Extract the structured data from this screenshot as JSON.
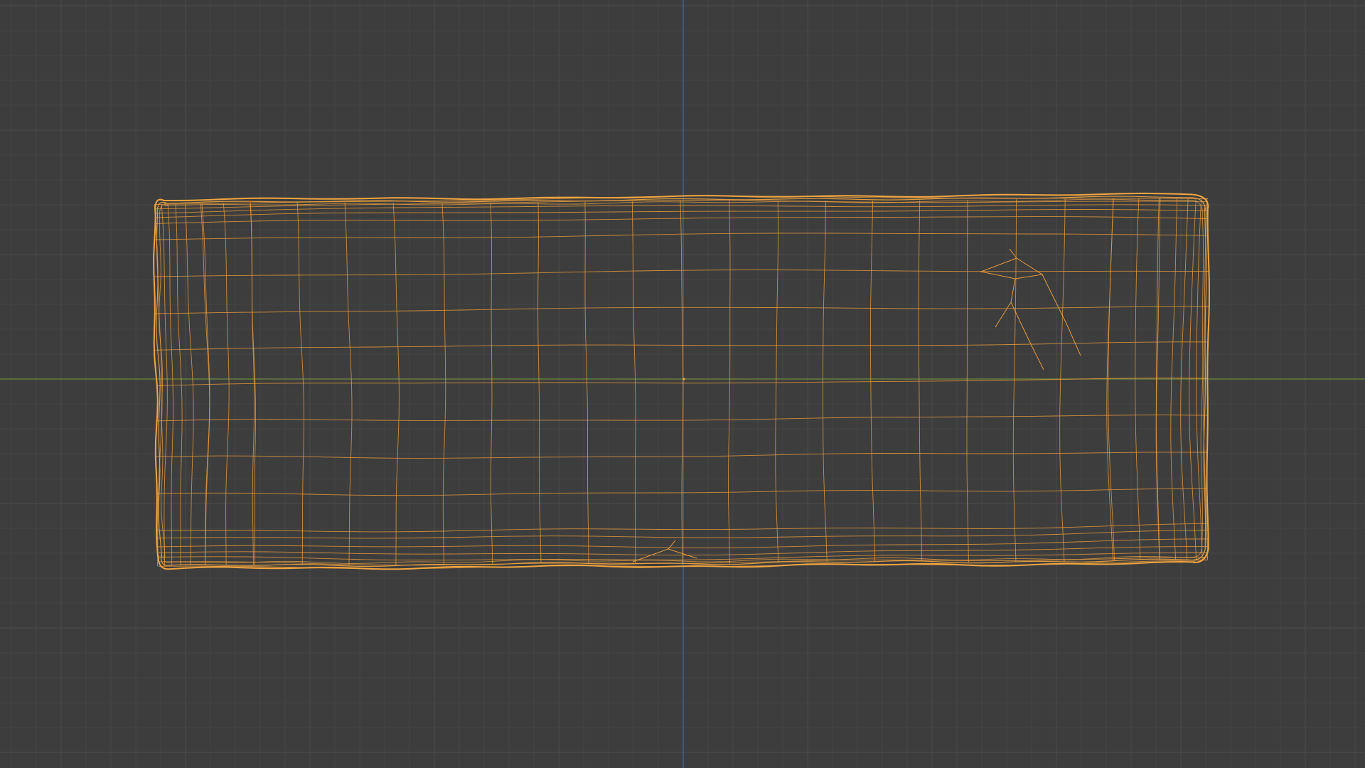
{
  "viewport": {
    "view": "top-orthographic",
    "shading": "wireframe",
    "grid": true,
    "axes": {
      "x_axis_visible": true,
      "y_axis_visible": true
    },
    "selected_object": {
      "name": "",
      "selected": true
    }
  },
  "colors": {
    "background": "#3d3d3d",
    "grid_minor": "#454545",
    "grid_major": "#4c4c4c",
    "axis_x": "#6d8a3e",
    "axis_y": "#3f6f9c",
    "wire_selected": "#e89a3a",
    "wire_outline": "#f2a640",
    "origin_dot": "#f2a640"
  }
}
